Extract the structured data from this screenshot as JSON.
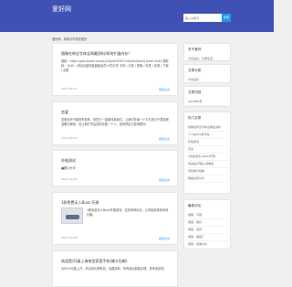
{
  "header": {
    "brand": "爱好网",
    "search_placeholder": "输入关键词",
    "search_button": "搜索"
  },
  "site_description": "爱好网，简单分享你的爱好",
  "posts": [
    {
      "title": "镜像在带全字体全网最资料/如何扩展内存？",
      "body": "链接：https://pan.baidu.com/s/1Ekjx0r309C7vXyKmjVwxQ pwd=1k4h 提取码：1k4h --来自百度网盘超级会员v7的分享 字体 / 分类 / 镜像 / 标签 / 资源 / 下载 / 合集",
      "meta": "2023-06-17",
      "more": "阅读全文"
    },
    {
      "title": "恋爱",
      "body": "恋爱也许不能带来很多，但是它一直陪伴着我们，让我们在每一个平凡的日子里感受温暖与期待，也让我们学会如何去爱一个人，如何把自己变得更好。",
      "meta": "2023-06-10",
      "more": "阅读全文"
    },
    {
      "title": "外链测试",
      "body": "■图片分享",
      "meta": "2023-06-05",
      "more": "阅读全文"
    },
    {
      "title": "1款免费无人Buzz 开源",
      "body": "1款免费无人Buzz开源游戏，支持多种玩法，让你轻松体验驾驶乐趣。",
      "meta": "2023-05-28",
      "more": "阅读全文"
    },
    {
      "title": "欢迎是/开展上海电信家宽手机(端卡包邮)",
      "body": "大约19元路上开，本活动长期有效，全国包邮，所有地区都能办理，快来参加吧。",
      "meta": "2023-05-20",
      "more": "阅读全文"
    }
  ],
  "sidebar": [
    {
      "title": "关于爱好",
      "items": [
        "分享爱好，记录生活"
      ]
    },
    {
      "title": "文章分类",
      "items": [
        "分享爱好"
      ]
    },
    {
      "title": "文章归档",
      "items": [
        "2023年6月"
      ]
    },
    {
      "title": "热门文章",
      "items": [
        "镜像在带全字体全网最资料",
        "个人在Win的平台",
        "外链测试",
        "恋爱",
        "1款免费无人Buzz开源",
        "欢迎是/开展上海电信",
        "手机端卡包邮",
        "网盘资源分享"
      ]
    },
    {
      "title": "最新评论",
      "items": [
        "游客：不错",
        "游客：很好",
        "游客：支持",
        "游客：收藏了",
        "游客：感谢分享"
      ]
    }
  ]
}
